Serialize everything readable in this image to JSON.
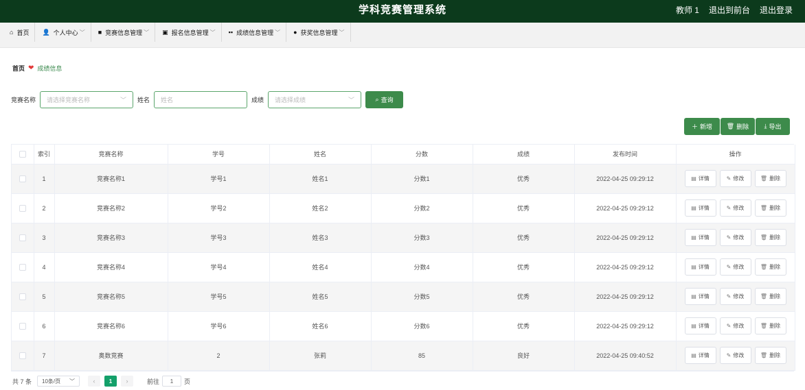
{
  "header": {
    "title": "学科竞赛管理系统",
    "user": "教师 1",
    "exit_front": "退出到前台",
    "logout": "退出登录"
  },
  "nav": [
    {
      "label": "首页",
      "icon": "home-icon",
      "chevron": false
    },
    {
      "label": "个人中心",
      "icon": "user-icon",
      "chevron": true
    },
    {
      "label": "竞赛信息管理",
      "icon": "briefcase-icon",
      "chevron": true
    },
    {
      "label": "报名信息管理",
      "icon": "clipboard-check-icon",
      "chevron": true
    },
    {
      "label": "成绩信息管理",
      "icon": "grid-icon",
      "chevron": true
    },
    {
      "label": "获奖信息管理",
      "icon": "map-pin-icon",
      "chevron": true
    }
  ],
  "breadcrumb": {
    "home": "首页",
    "current": "成绩信息"
  },
  "search": {
    "contest_label": "竞赛名称",
    "contest_placeholder": "请选择竞赛名称",
    "name_label": "姓名",
    "name_placeholder": "姓名",
    "grade_label": "成绩",
    "grade_placeholder": "请选择成绩",
    "query_button": "查询"
  },
  "actions": {
    "add": "新增",
    "delete": "删除",
    "export": "导出"
  },
  "table": {
    "headers": [
      "索引",
      "竞赛名称",
      "学号",
      "姓名",
      "分数",
      "成绩",
      "发布时间",
      "操作"
    ],
    "rows": [
      {
        "index": "1",
        "contest": "竞赛名称1",
        "student_no": "学号1",
        "name": "姓名1",
        "score": "分数1",
        "grade": "优秀",
        "time": "2022-04-25 09:29:12"
      },
      {
        "index": "2",
        "contest": "竞赛名称2",
        "student_no": "学号2",
        "name": "姓名2",
        "score": "分数2",
        "grade": "优秀",
        "time": "2022-04-25 09:29:12"
      },
      {
        "index": "3",
        "contest": "竞赛名称3",
        "student_no": "学号3",
        "name": "姓名3",
        "score": "分数3",
        "grade": "优秀",
        "time": "2022-04-25 09:29:12"
      },
      {
        "index": "4",
        "contest": "竞赛名称4",
        "student_no": "学号4",
        "name": "姓名4",
        "score": "分数4",
        "grade": "优秀",
        "time": "2022-04-25 09:29:12"
      },
      {
        "index": "5",
        "contest": "竞赛名称5",
        "student_no": "学号5",
        "name": "姓名5",
        "score": "分数5",
        "grade": "优秀",
        "time": "2022-04-25 09:29:12"
      },
      {
        "index": "6",
        "contest": "竞赛名称6",
        "student_no": "学号6",
        "name": "姓名6",
        "score": "分数6",
        "grade": "优秀",
        "time": "2022-04-25 09:29:12"
      },
      {
        "index": "7",
        "contest": "奥数竞赛",
        "student_no": "2",
        "name": "张莉",
        "score": "85",
        "grade": "良好",
        "time": "2022-04-25 09:40:52"
      }
    ],
    "row_actions": {
      "detail": "详情",
      "edit": "修改",
      "delete": "删除"
    }
  },
  "pagination": {
    "total": "共 7 条",
    "page_size": "10条/页",
    "current_page": "1",
    "goto_label": "前往",
    "goto_value": "1",
    "page_unit": "页"
  },
  "colors": {
    "header_bg": "#0c3a1c",
    "accent_green": "#3d8b4b",
    "page_active": "#14a06a"
  }
}
